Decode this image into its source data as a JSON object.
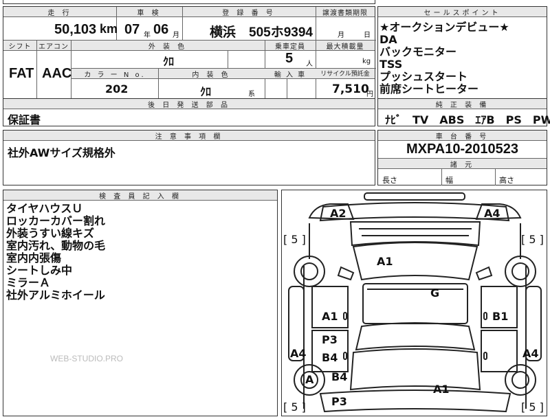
{
  "top_strip": {
    "partial_text": ""
  },
  "headers": {
    "mileage": "走 行",
    "inspection": "車 検",
    "registration": "登 録 番 号",
    "transfer": "譲渡書類期限",
    "sales_points": "セールスポイント",
    "shift": "シフト",
    "aircon": "エアコン",
    "exterior_color": "外 装 色",
    "capacity": "乗車定員",
    "max_load": "最大積載量",
    "color_no": "カ ラ ー N o.",
    "interior_color": "内 装 色",
    "import": "輸 入 車",
    "recycle": "リサイクル預託金",
    "later_parts": "後 日 発 送 部 品",
    "genuine_equipment": "純 正 装 備",
    "notes": "注 意 事 項 欄",
    "chassis_no": "車 台 番 号",
    "dimensions": "諸 元",
    "inspector_notes": "検 査 員 記 入 欄"
  },
  "vehicle": {
    "mileage_value": "50,103",
    "mileage_unit": "km",
    "inspection_year": "07",
    "inspection_year_unit": "年",
    "inspection_month": "06",
    "inspection_month_unit": "月",
    "registration": "横浜　505ホ9394",
    "transfer_month": "月",
    "transfer_day": "日",
    "shift": "FAT",
    "aircon": "AAC",
    "exterior_color": "ｸﾛ",
    "capacity": "5",
    "capacity_unit": "人",
    "max_load_unit": "kg",
    "color_no": "202",
    "interior_color": "ｸﾛ",
    "interior_suffix": "系",
    "recycle_fee": "7,510",
    "recycle_unit": "円",
    "chassis_no": "MXPA10-2010523"
  },
  "sales_points": [
    "★オークションデビュー★",
    "DA",
    "バックモニター",
    "TSS",
    "プッシュスタート",
    "前席シートヒーター"
  ],
  "later_parts_value": "保証書",
  "genuine_equipment_value": "ﾅﾋﾞ　TV　ABS　ｴｱB　PS　PW",
  "notes_value": "社外AWサイズ規格外",
  "dimensions_labels": {
    "length": "長さ",
    "width": "幅",
    "height": "高さ"
  },
  "inspector_items": [
    "タイヤハウスＵ",
    "ロッカーカバー割れ",
    "外装うすい線キズ",
    "室内汚れ、動物の毛",
    "室内内張傷",
    "シートしみ中",
    "ミラーＡ",
    "社外アルミホイール"
  ],
  "watermark": "WEB-STUDIO.PRO",
  "diagram_marks": {
    "front_left_corner": "A2",
    "front_right_corner": "A4",
    "tire_front_left": "[ 5 ]",
    "tire_front_right": "[ 5 ]",
    "hood": "A1",
    "roof": "G",
    "left_front_door": "A1",
    "right_front_door": "B1",
    "left_rear_door_1": "P3",
    "left_rear_door_2": "B4",
    "left_side": "A4",
    "right_side": "A4",
    "left_rear_wheel": "A",
    "left_rear_fender": "B4",
    "left_rear_lower": "P3",
    "trunk": "A1",
    "tire_rear_left": "[ 5 ]",
    "tire_rear_right": "[ 5 ]"
  }
}
